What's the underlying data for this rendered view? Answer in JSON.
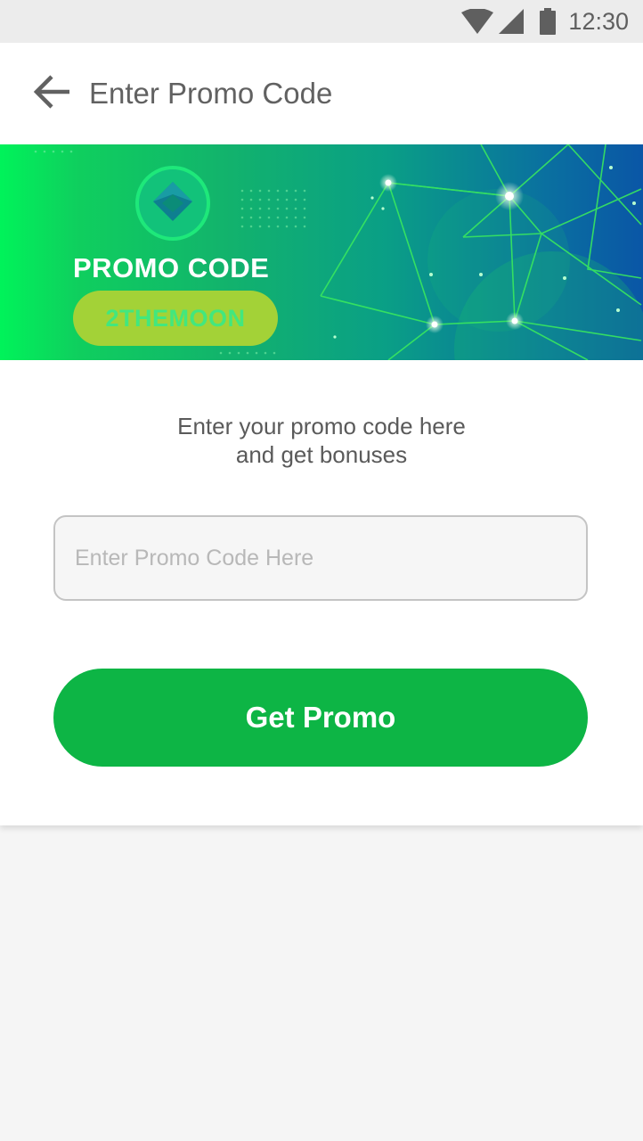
{
  "status_bar": {
    "time": "12:30",
    "icons": [
      "wifi-icon",
      "signal-icon",
      "battery-icon"
    ]
  },
  "app_bar": {
    "back_icon": "arrow-left-icon",
    "title": "Enter Promo Code"
  },
  "banner": {
    "heading": "PROMO CODE",
    "code": "2THEMOON",
    "logo_icon": "diamond-logo-icon"
  },
  "form": {
    "instructions_line1": "Enter your promo code here",
    "instructions_line2": "and get bonuses",
    "input_value": "",
    "input_placeholder": "Enter Promo Code Here",
    "submit_label": "Get Promo"
  },
  "colors": {
    "accent": "#0db545",
    "statusbar_bg": "#ececec",
    "page_bg": "#f5f5f5",
    "banner_start": "#00f35a",
    "banner_end": "#0a56a6"
  }
}
